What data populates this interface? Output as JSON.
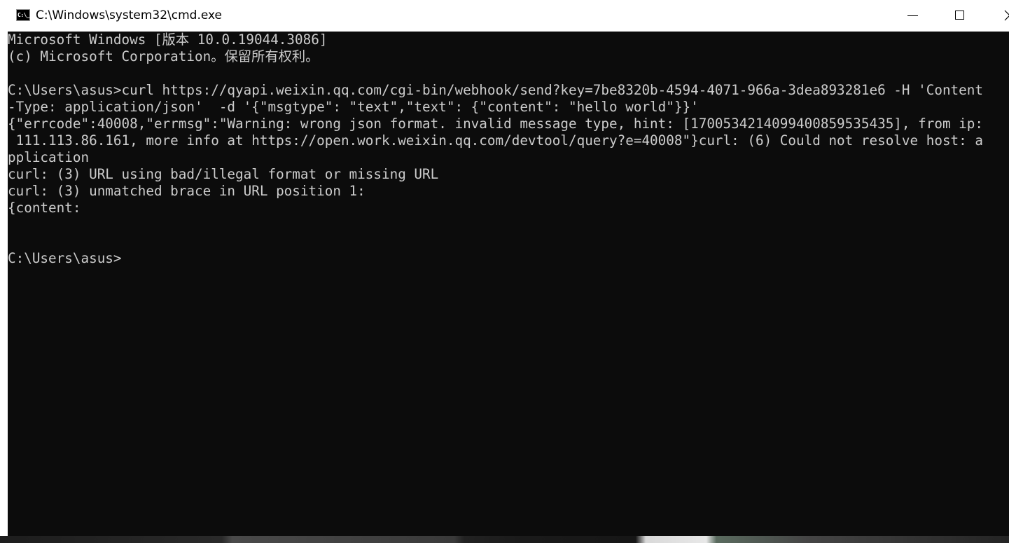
{
  "window": {
    "title": "C:\\Windows\\system32\\cmd.exe",
    "icon": "console-app-icon",
    "icon_text": "C:\\_"
  },
  "controls": {
    "minimize_icon": "minimize-icon",
    "maximize_icon": "maximize-icon",
    "close_icon": "close-icon"
  },
  "console": {
    "colors": {
      "background": "#0c0c0c",
      "foreground": "#cccccc"
    },
    "lines": [
      "Microsoft Windows [版本 10.0.19044.3086]",
      "(c) Microsoft Corporation。保留所有权利。",
      "",
      "C:\\Users\\asus>curl https://qyapi.weixin.qq.com/cgi-bin/webhook/send?key=7be8320b-4594-4071-966a-3dea893281e6 -H 'Content",
      "-Type: application/json'  -d '{\"msgtype\": \"text\",\"text\": {\"content\": \"hello world\"}}'",
      "{\"errcode\":40008,\"errmsg\":\"Warning: wrong json format. invalid message type, hint: [1700534214099400859535435], from ip:",
      " 111.113.86.161, more info at https://open.work.weixin.qq.com/devtool/query?e=40008\"}curl: (6) Could not resolve host: a",
      "pplication",
      "curl: (3) URL using bad/illegal format or missing URL",
      "curl: (3) unmatched brace in URL position 1:",
      "{content:",
      "",
      "",
      "C:\\Users\\asus>"
    ]
  }
}
